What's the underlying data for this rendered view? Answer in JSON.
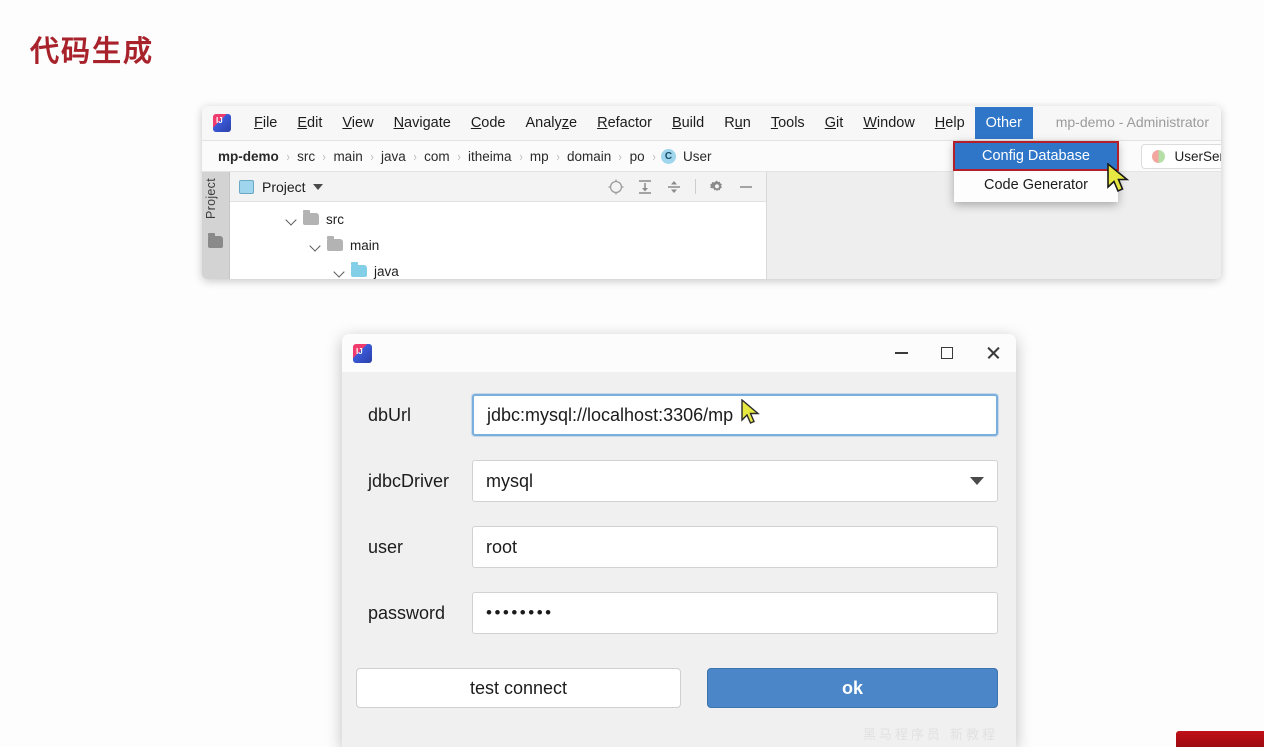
{
  "slide": {
    "title": "代码生成",
    "title_color": "#a8222b"
  },
  "ide": {
    "window_title": "mp-demo - Administrator",
    "menus": [
      {
        "pre": "",
        "mn": "F",
        "post": "ile"
      },
      {
        "pre": "",
        "mn": "E",
        "post": "dit"
      },
      {
        "pre": "",
        "mn": "V",
        "post": "iew"
      },
      {
        "pre": "",
        "mn": "N",
        "post": "avigate"
      },
      {
        "pre": "",
        "mn": "C",
        "post": "ode"
      },
      {
        "pre": "Analy",
        "mn": "z",
        "post": "e"
      },
      {
        "pre": "",
        "mn": "R",
        "post": "efactor"
      },
      {
        "pre": "",
        "mn": "B",
        "post": "uild"
      },
      {
        "pre": "R",
        "mn": "u",
        "post": "n"
      },
      {
        "pre": "",
        "mn": "T",
        "post": "ools"
      },
      {
        "pre": "",
        "mn": "G",
        "post": "it"
      },
      {
        "pre": "",
        "mn": "W",
        "post": "indow"
      },
      {
        "pre": "",
        "mn": "H",
        "post": "elp"
      }
    ],
    "active_menu": "Other",
    "dropdown": {
      "items": [
        {
          "label": "Config Database",
          "selected": true
        },
        {
          "label": "Code Generator",
          "selected": false
        }
      ],
      "selected_border_color": "#b4202a",
      "selected_bg_color": "#2f76c8"
    },
    "breadcrumb": {
      "items": [
        "mp-demo",
        "src",
        "main",
        "java",
        "com",
        "itheima",
        "mp",
        "domain",
        "po"
      ],
      "separator": "›",
      "class_badge": "C",
      "class_name": "User"
    },
    "editor_tab": {
      "label": "UserSer"
    },
    "tool_strip": {
      "label": "Project"
    },
    "panel": {
      "title": "Project",
      "tools": [
        "locate-icon",
        "expand-all-icon",
        "collapse-all-icon",
        "settings-gear-icon",
        "hide-icon"
      ]
    },
    "tree": [
      {
        "label": "src",
        "depth": 1,
        "folder_color": "gray"
      },
      {
        "label": "main",
        "depth": 2,
        "folder_color": "gray"
      },
      {
        "label": "java",
        "depth": 3,
        "folder_color": "blue"
      }
    ]
  },
  "dialog": {
    "fields": [
      {
        "label": "dbUrl",
        "value": "jdbc:mysql://localhost:3306/mp",
        "type": "text",
        "focused": true
      },
      {
        "label": "jdbcDriver",
        "value": "mysql",
        "type": "select",
        "focused": false
      },
      {
        "label": "user",
        "value": "root",
        "type": "text",
        "focused": false
      },
      {
        "label": "password",
        "value": "••••••••",
        "type": "password",
        "focused": false
      }
    ],
    "buttons": {
      "secondary": "test connect",
      "primary": "ok",
      "primary_color": "#4a86c8"
    },
    "window_buttons": [
      "minimize-icon",
      "maximize-icon",
      "close-icon"
    ],
    "watermark": "黑马程序员 新教程"
  }
}
